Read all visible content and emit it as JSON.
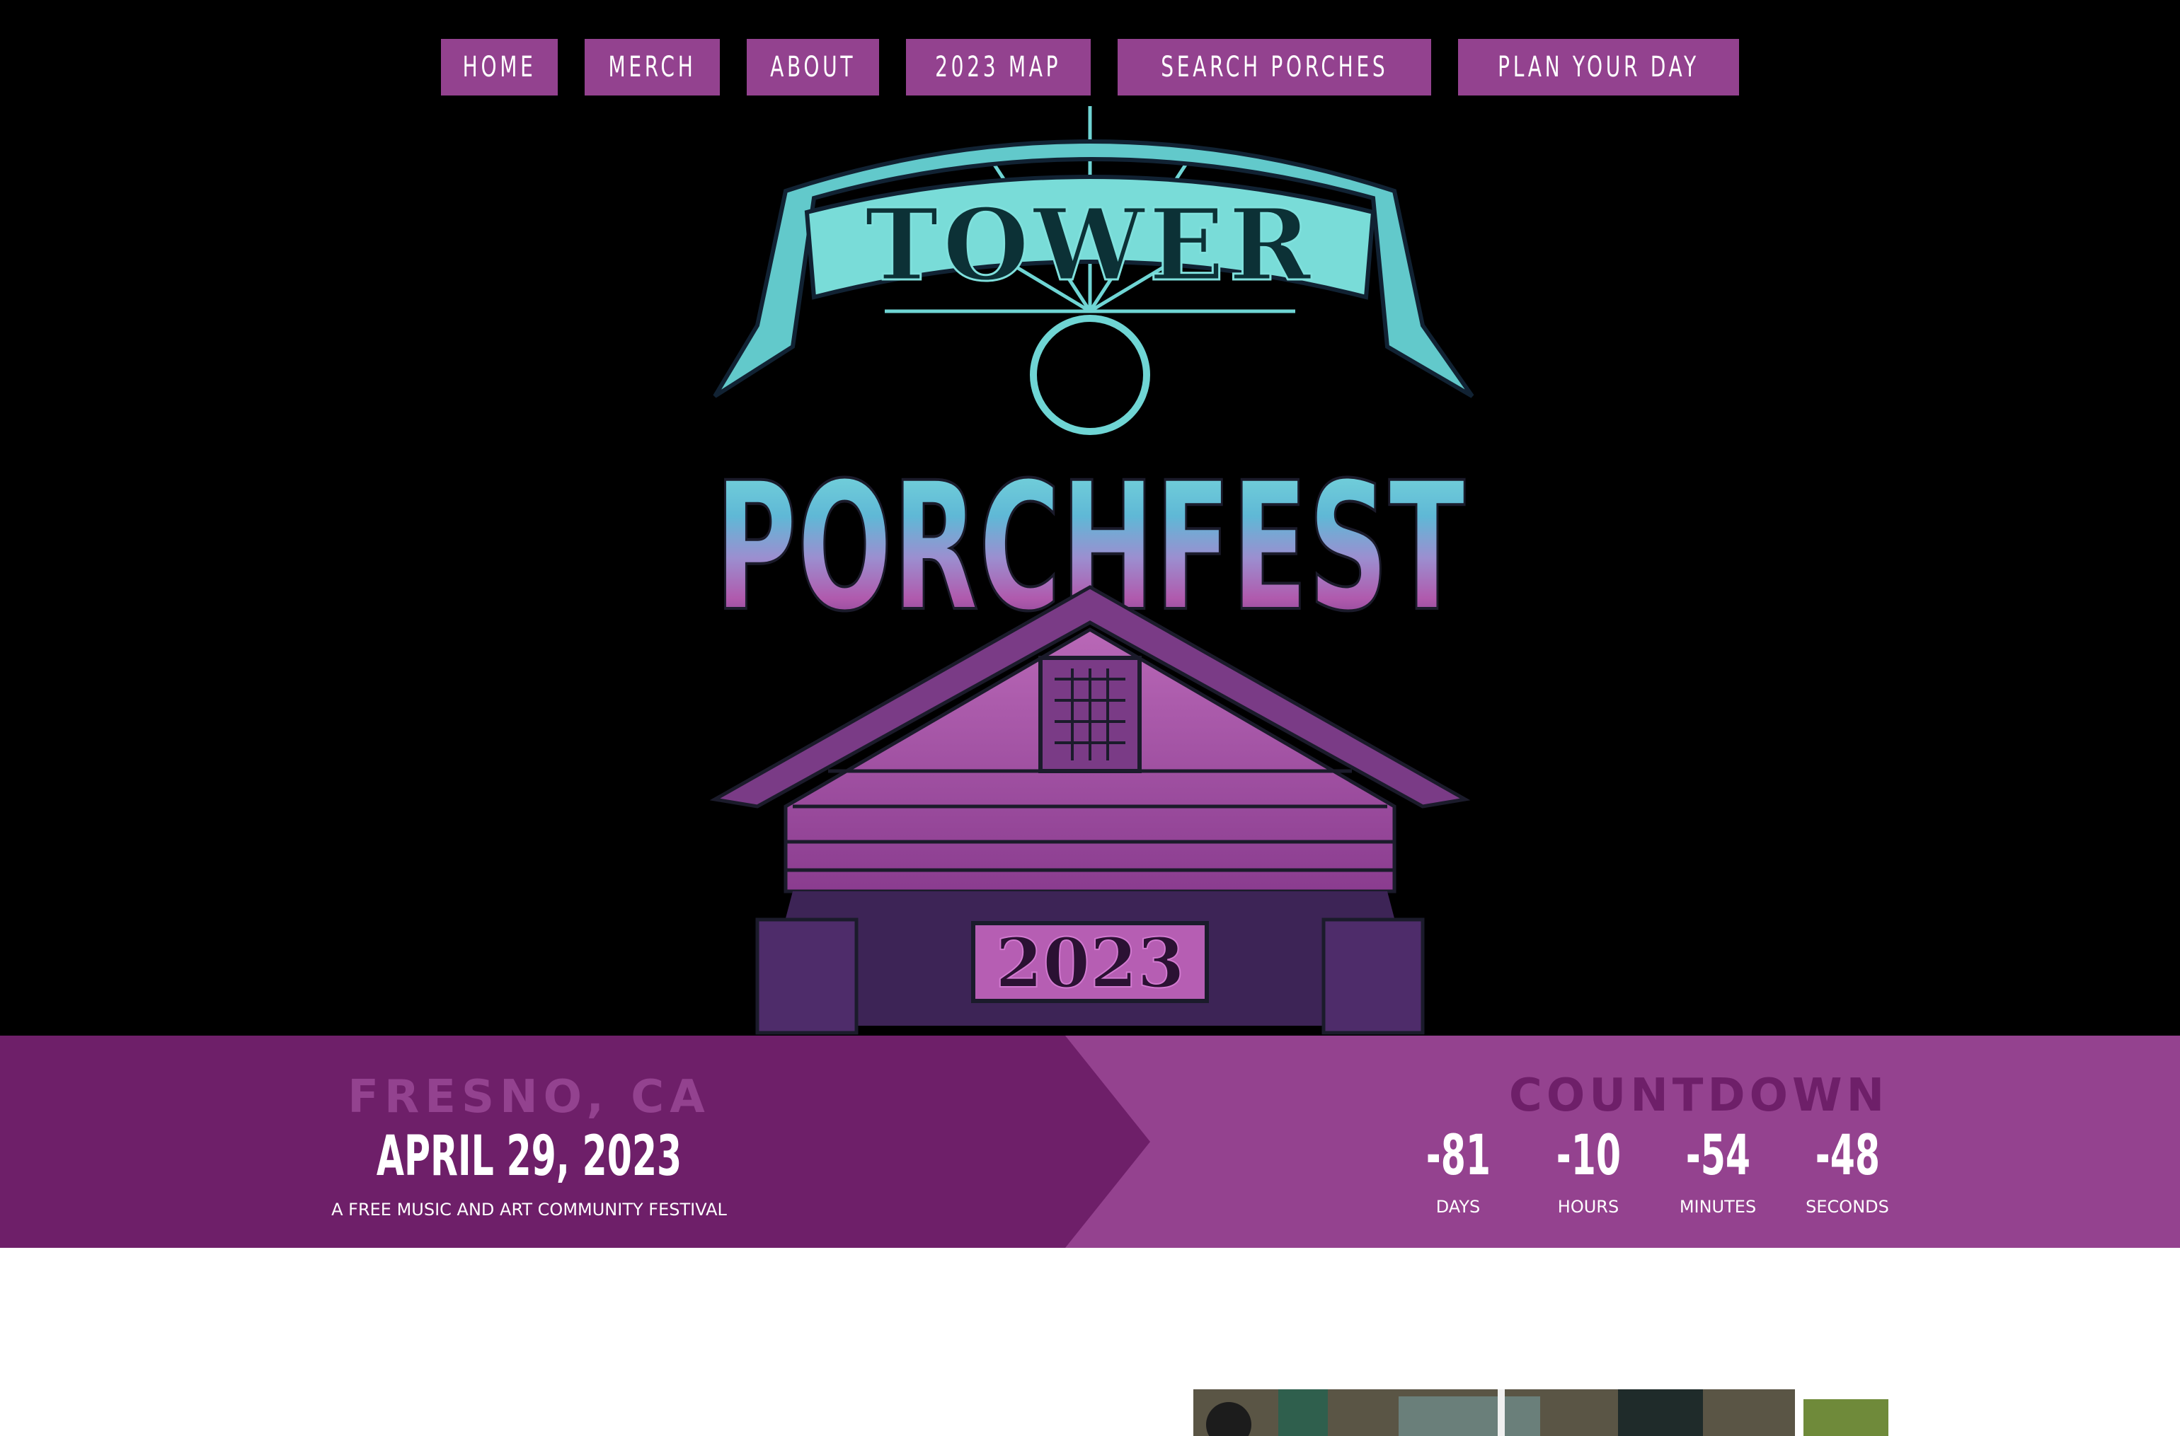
{
  "nav": {
    "items": [
      {
        "label": "HOME"
      },
      {
        "label": "MERCH"
      },
      {
        "label": "ABOUT"
      },
      {
        "label": "2023 MAP"
      },
      {
        "label": "SEARCH PORCHES"
      },
      {
        "label": "PLAN YOUR DAY"
      }
    ]
  },
  "poster": {
    "top_word": "TOWER",
    "main_word": "PORCHFEST",
    "year": "2023"
  },
  "event": {
    "location": "FRESNO, CA",
    "date": "APRIL 29, 2023",
    "tagline": "A FREE MUSIC AND ART COMMUNITY FESTIVAL"
  },
  "countdown": {
    "title": "COUNTDOWN",
    "units": [
      {
        "value": "-81",
        "label": "DAYS"
      },
      {
        "value": "-10",
        "label": "HOURS"
      },
      {
        "value": "-54",
        "label": "MINUTES"
      },
      {
        "value": "-48",
        "label": "SECONDS"
      }
    ]
  },
  "colors": {
    "nav_bg": "#93428f",
    "band_dark": "#6e1f69",
    "band_light": "#94428f",
    "poster_teal": "#6fd5d4",
    "poster_purple": "#a055a8"
  }
}
